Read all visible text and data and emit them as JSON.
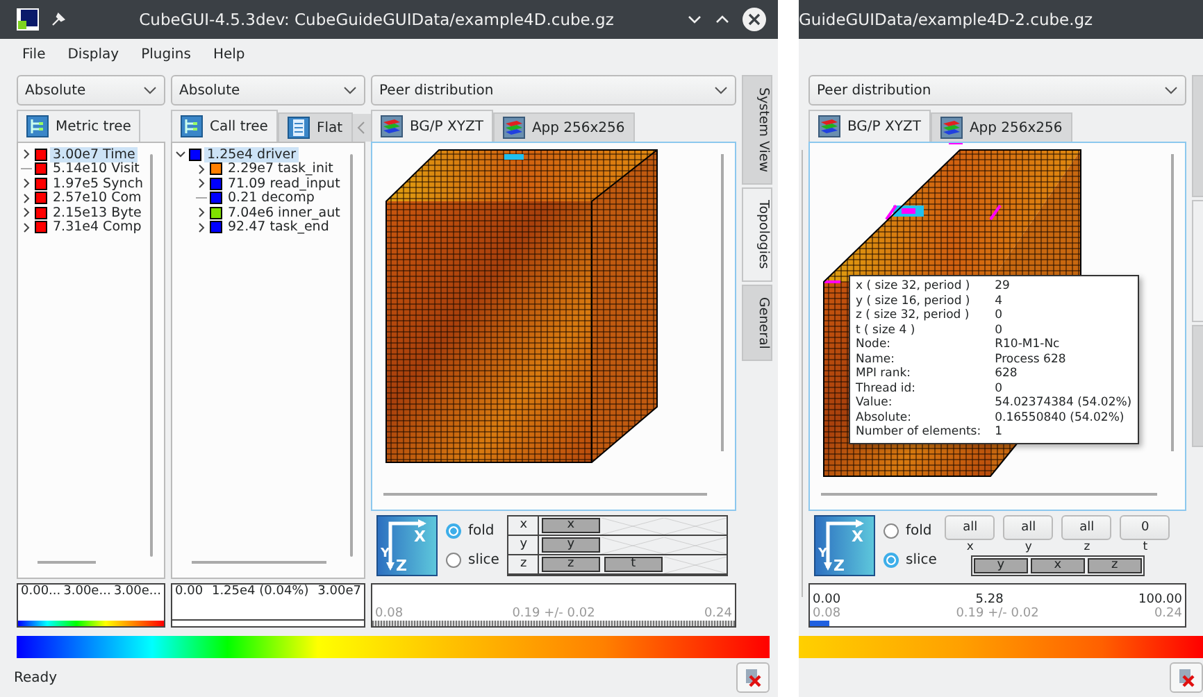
{
  "left_window": {
    "title": "CubeGUI-4.5.3dev: CubeGuideGUIData/example4D.cube.gz",
    "menu": [
      "File",
      "Display",
      "Plugins",
      "Help"
    ],
    "metric_pane": {
      "dropdown": "Absolute",
      "tabs": [
        {
          "label": "Metric tree",
          "selected": true
        }
      ],
      "tree": [
        {
          "kind": "collapsed",
          "text": "3.00e7 Time",
          "color": "#ff0000",
          "selected": true
        },
        {
          "kind": "leaf",
          "text": "5.14e10 Visit",
          "color": "#ff0000",
          "selected": false
        },
        {
          "kind": "collapsed",
          "text": "1.97e5 Synch",
          "color": "#ff0000",
          "selected": false
        },
        {
          "kind": "collapsed",
          "text": "2.57e10 Com",
          "color": "#ff0000",
          "selected": false
        },
        {
          "kind": "collapsed",
          "text": "2.15e13 Byte",
          "color": "#ff0000",
          "selected": false
        },
        {
          "kind": "collapsed",
          "text": "7.31e4 Comp",
          "color": "#ff0000",
          "selected": false
        }
      ],
      "value_labels": [
        "0.00...",
        "3.00e...",
        "3.00e..."
      ],
      "gradient": true
    },
    "call_pane": {
      "dropdown": "Absolute",
      "tabs": [
        {
          "label": "Call tree",
          "selected": true
        },
        {
          "label": "Flat",
          "selected": false
        }
      ],
      "tree": [
        {
          "kind": "expanded",
          "text": "1.25e4 driver",
          "color": "#0000ff",
          "selected": true,
          "children": [
            {
              "kind": "collapsed",
              "text": "2.29e7 task_init",
              "color": "#ff7f00",
              "selected": false
            },
            {
              "kind": "collapsed",
              "text": "71.09 read_input",
              "color": "#0000ff",
              "selected": false
            },
            {
              "kind": "leaf",
              "text": "0.21 decomp",
              "color": "#0000ff",
              "selected": false
            },
            {
              "kind": "collapsed",
              "text": "7.04e6 inner_aut",
              "color": "#80e000",
              "selected": false
            },
            {
              "kind": "collapsed",
              "text": "92.47 task_end",
              "color": "#0000ff",
              "selected": false
            }
          ]
        }
      ],
      "value_labels": [
        "0.00",
        "1.25e4 (0.04%)",
        "3.00e7"
      ],
      "gradient": false
    },
    "topology_pane": {
      "dropdown": "Peer distribution",
      "tabs": [
        {
          "label": "BG/P XYZT",
          "selected": true
        },
        {
          "label": "App 256x256",
          "selected": false
        }
      ],
      "axis_icon": [
        "X",
        "Y",
        "Z"
      ],
      "modes": [
        {
          "label": "fold",
          "selected": true
        },
        {
          "label": "slice",
          "selected": false
        }
      ],
      "controls": {
        "kind": "fold_grid",
        "rows": [
          {
            "axis": "x",
            "chips": [
              "x"
            ]
          },
          {
            "axis": "y",
            "chips": [
              "y"
            ]
          },
          {
            "axis": "z",
            "chips": [
              "z",
              "t"
            ]
          }
        ]
      },
      "value_bar": {
        "stats": [
          "0.08",
          "0.19 +/- 0.02",
          "0.24"
        ]
      }
    },
    "side_tabs": [
      {
        "label": "System View",
        "selected": false
      },
      {
        "label": "Topologies",
        "selected": true
      },
      {
        "label": "General",
        "selected": false
      }
    ],
    "status": "Ready"
  },
  "right_window": {
    "title": "GuideGUIData/example4D-2.cube.gz",
    "topology_pane": {
      "dropdown": "Peer distribution",
      "tabs": [
        {
          "label": "BG/P XYZT",
          "selected": true
        },
        {
          "label": "App 256x256",
          "selected": false
        }
      ],
      "tooltip": [
        [
          "x ( size 32, period  )",
          "29"
        ],
        [
          "y ( size 16, period  )",
          "4"
        ],
        [
          "z ( size 32, period  )",
          "0"
        ],
        [
          "t ( size 4 )",
          "0"
        ],
        [
          "Node:",
          "R10-M1-Nc"
        ],
        [
          "Name:",
          "Process 628"
        ],
        [
          "MPI rank:",
          "628"
        ],
        [
          "Thread id:",
          "0"
        ],
        [
          "Value:",
          "54.02374384 (54.02%)"
        ],
        [
          "Absolute:",
          "0.16550840 (54.02%)"
        ],
        [
          "Number of elements:",
          "1"
        ]
      ],
      "axis_icon": [
        "X",
        "Y",
        "Z"
      ],
      "modes": [
        {
          "label": "fold",
          "selected": false
        },
        {
          "label": "slice",
          "selected": true
        }
      ],
      "controls": {
        "kind": "slice_buttons",
        "buttons": [
          {
            "label": "all",
            "axis": "x"
          },
          {
            "label": "all",
            "axis": "y"
          },
          {
            "label": "all",
            "axis": "z"
          },
          {
            "label": "0",
            "axis": "t"
          }
        ],
        "chips": [
          "y",
          "x",
          "z"
        ]
      },
      "value_bar": {
        "scale": [
          "0.00",
          "5.28",
          "100.00"
        ],
        "stats": [
          "0.08",
          "0.19 +/- 0.02",
          "0.24"
        ],
        "level": 0.05
      }
    },
    "side_tabs": [
      {
        "selected": false
      },
      {
        "selected": true
      },
      {
        "selected": false
      }
    ]
  }
}
